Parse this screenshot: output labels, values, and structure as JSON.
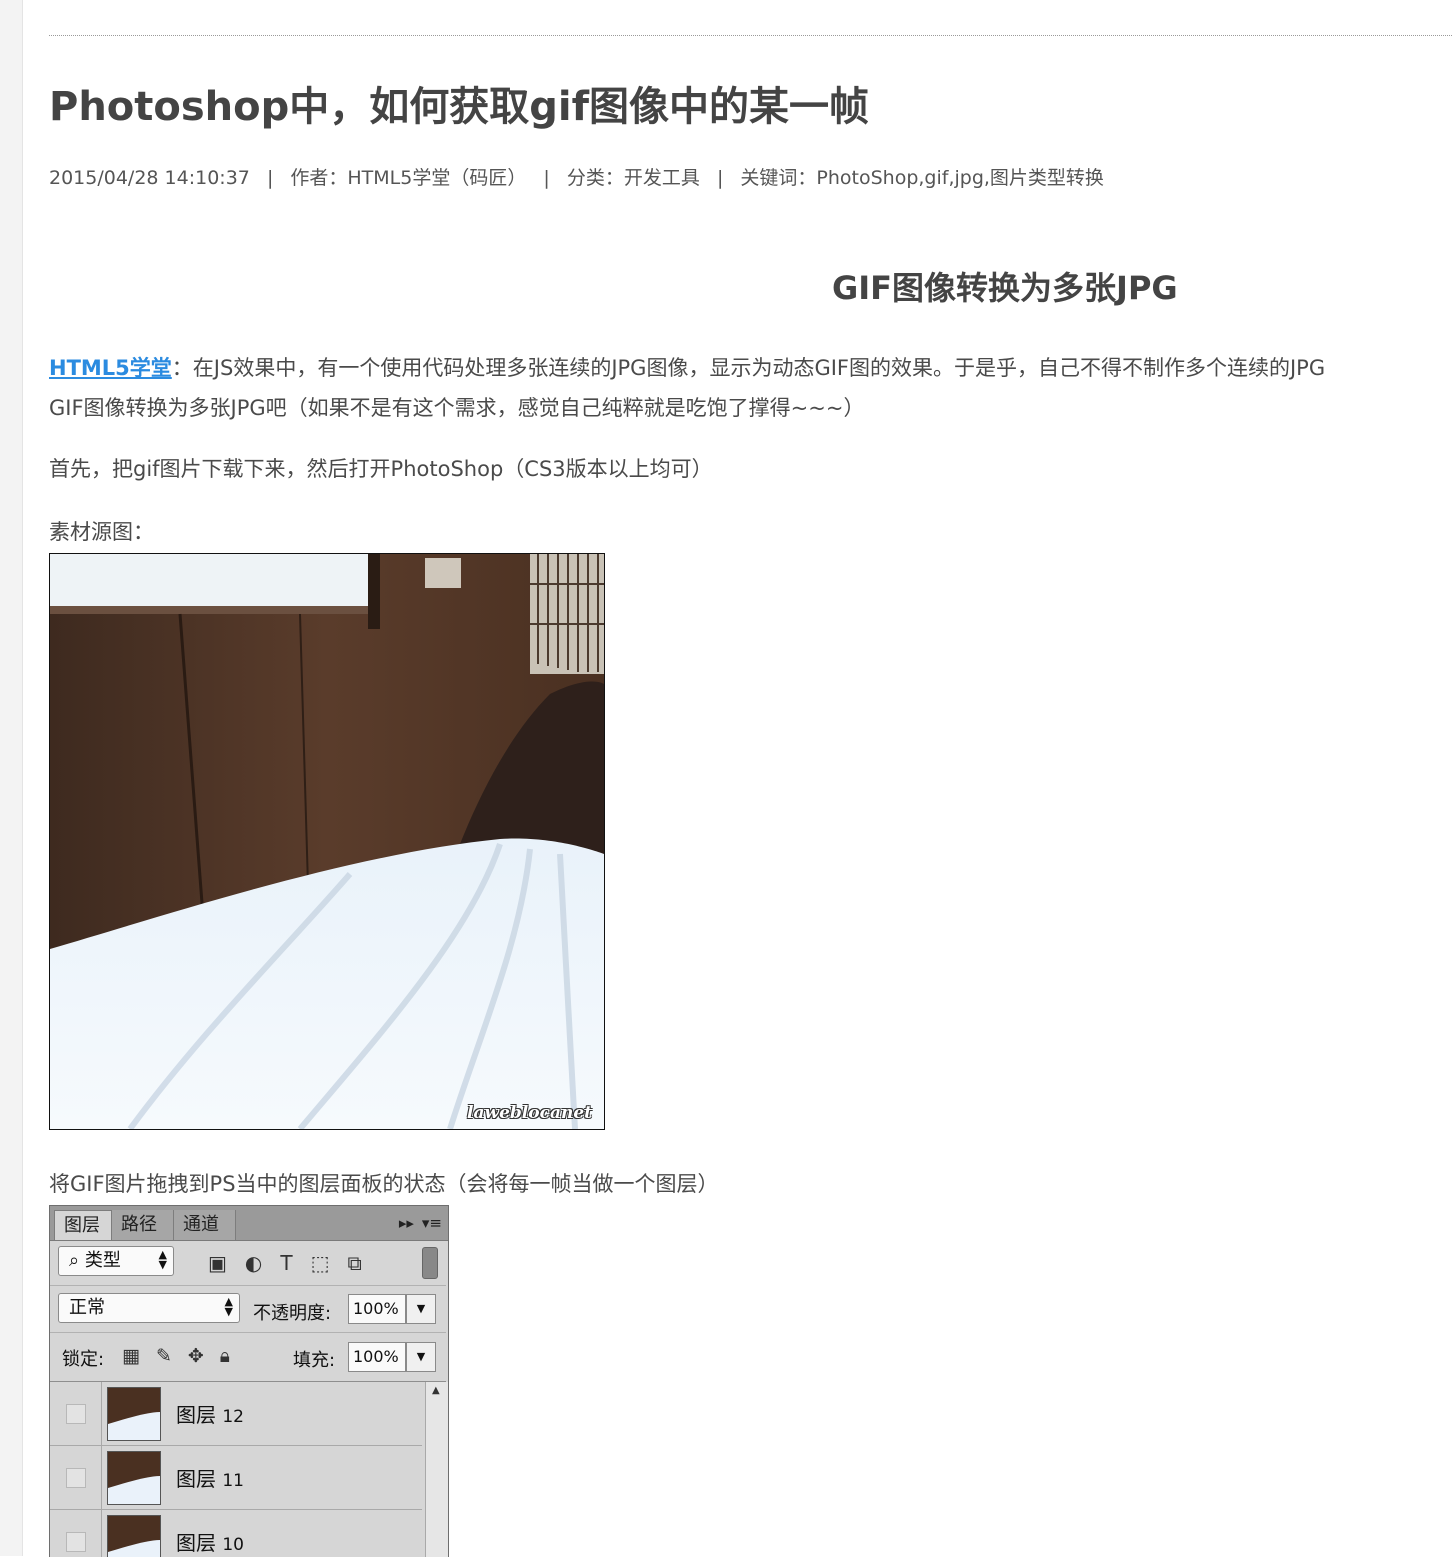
{
  "article": {
    "title": "Photoshop中，如何获取gif图像中的某一帧",
    "meta": {
      "datetime": "2015/04/28 14:10:37",
      "separator": "|",
      "author": "作者：HTML5学堂（码匠）",
      "category_label": "分类：",
      "category_value": "开发工具",
      "keywords": "关键词：PhotoShop,gif,jpg,图片类型转换"
    },
    "subheading": "GIF图像转换为多张JPG",
    "intro": {
      "brand_link": "HTML5学堂",
      "line1_rest": "：在JS效果中，有一个使用代码处理多张连续的JPG图像，显示为动态GIF图的效果。于是乎，自己不得不制作多个连续的JPG",
      "line2": "GIF图像转换为多张JPG吧（如果不是有这个需求，感觉自己纯粹就是吃饱了撑得~~~）"
    },
    "step_first": "首先，把gif图片下载下来，然后打开PhotoShop（CS3版本以上均可）",
    "source_label": "素材源图：",
    "source_watermark": "laweblocanet",
    "drag_caption": "将GIF图片拖拽到PS当中的图层面板的状态（会将每一帧当做一个图层）"
  },
  "ps_panel": {
    "tabs": [
      "图层",
      "路径",
      "通道"
    ],
    "kind_select": "类型",
    "blend_mode": "正常",
    "opacity_label": "不透明度:",
    "opacity_value": "100%",
    "lock_label": "锁定:",
    "fill_label": "填充:",
    "fill_value": "100%",
    "layers": [
      {
        "name": "图层",
        "num": "12"
      },
      {
        "name": "图层",
        "num": "11"
      },
      {
        "name": "图层",
        "num": "10"
      }
    ],
    "icons": {
      "tab_menu": "double-arrow-icon",
      "panel_menu": "panel-menu-icon",
      "filters": [
        "image-filter-icon",
        "adjustment-filter-icon",
        "type-filter-icon",
        "shape-filter-icon",
        "smart-object-filter-icon"
      ],
      "locks": [
        "lock-transparent-icon",
        "lock-paint-icon",
        "lock-move-icon",
        "lock-all-icon"
      ]
    }
  }
}
